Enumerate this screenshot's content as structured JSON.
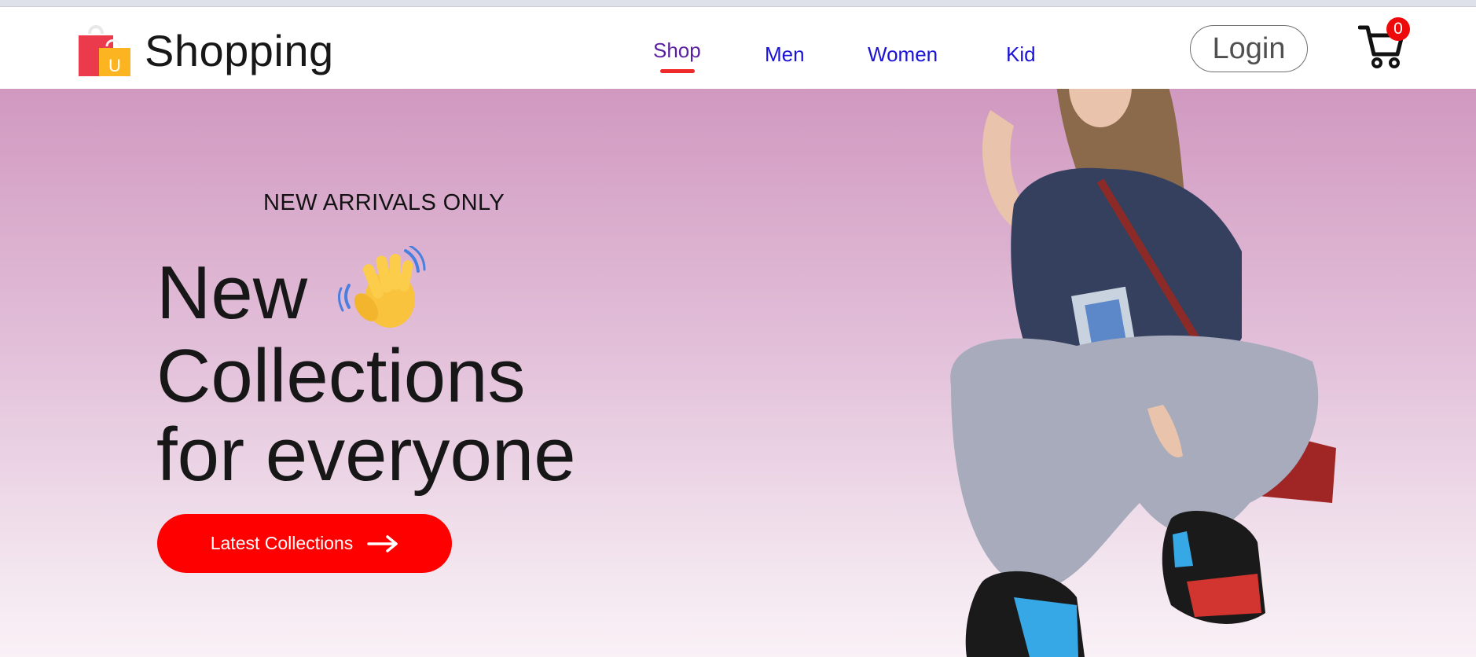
{
  "brand": {
    "name": "Shopping",
    "logo_icon": "shopping-bags-icon",
    "logo_letter": "U"
  },
  "nav": {
    "links": [
      {
        "label": "Shop",
        "active": true
      },
      {
        "label": "Men",
        "active": false
      },
      {
        "label": "Women",
        "active": false
      },
      {
        "label": "Kid",
        "active": false
      }
    ],
    "login_label": "Login",
    "cart_icon": "cart-icon",
    "cart_count": "0"
  },
  "hero": {
    "kicker": "NEW ARRIVALS ONLY",
    "headline": [
      "New",
      "Collections",
      "for everyone"
    ],
    "wave_icon": "waving-hand-icon",
    "cta_label": "Latest Collections",
    "cta_icon": "arrow-right-icon",
    "image": "model-photo"
  },
  "colors": {
    "accent": "#ff0000",
    "nav_link": "#1a13d6",
    "hero_top": "#d199c0",
    "hero_bottom": "#f9f1f6"
  }
}
